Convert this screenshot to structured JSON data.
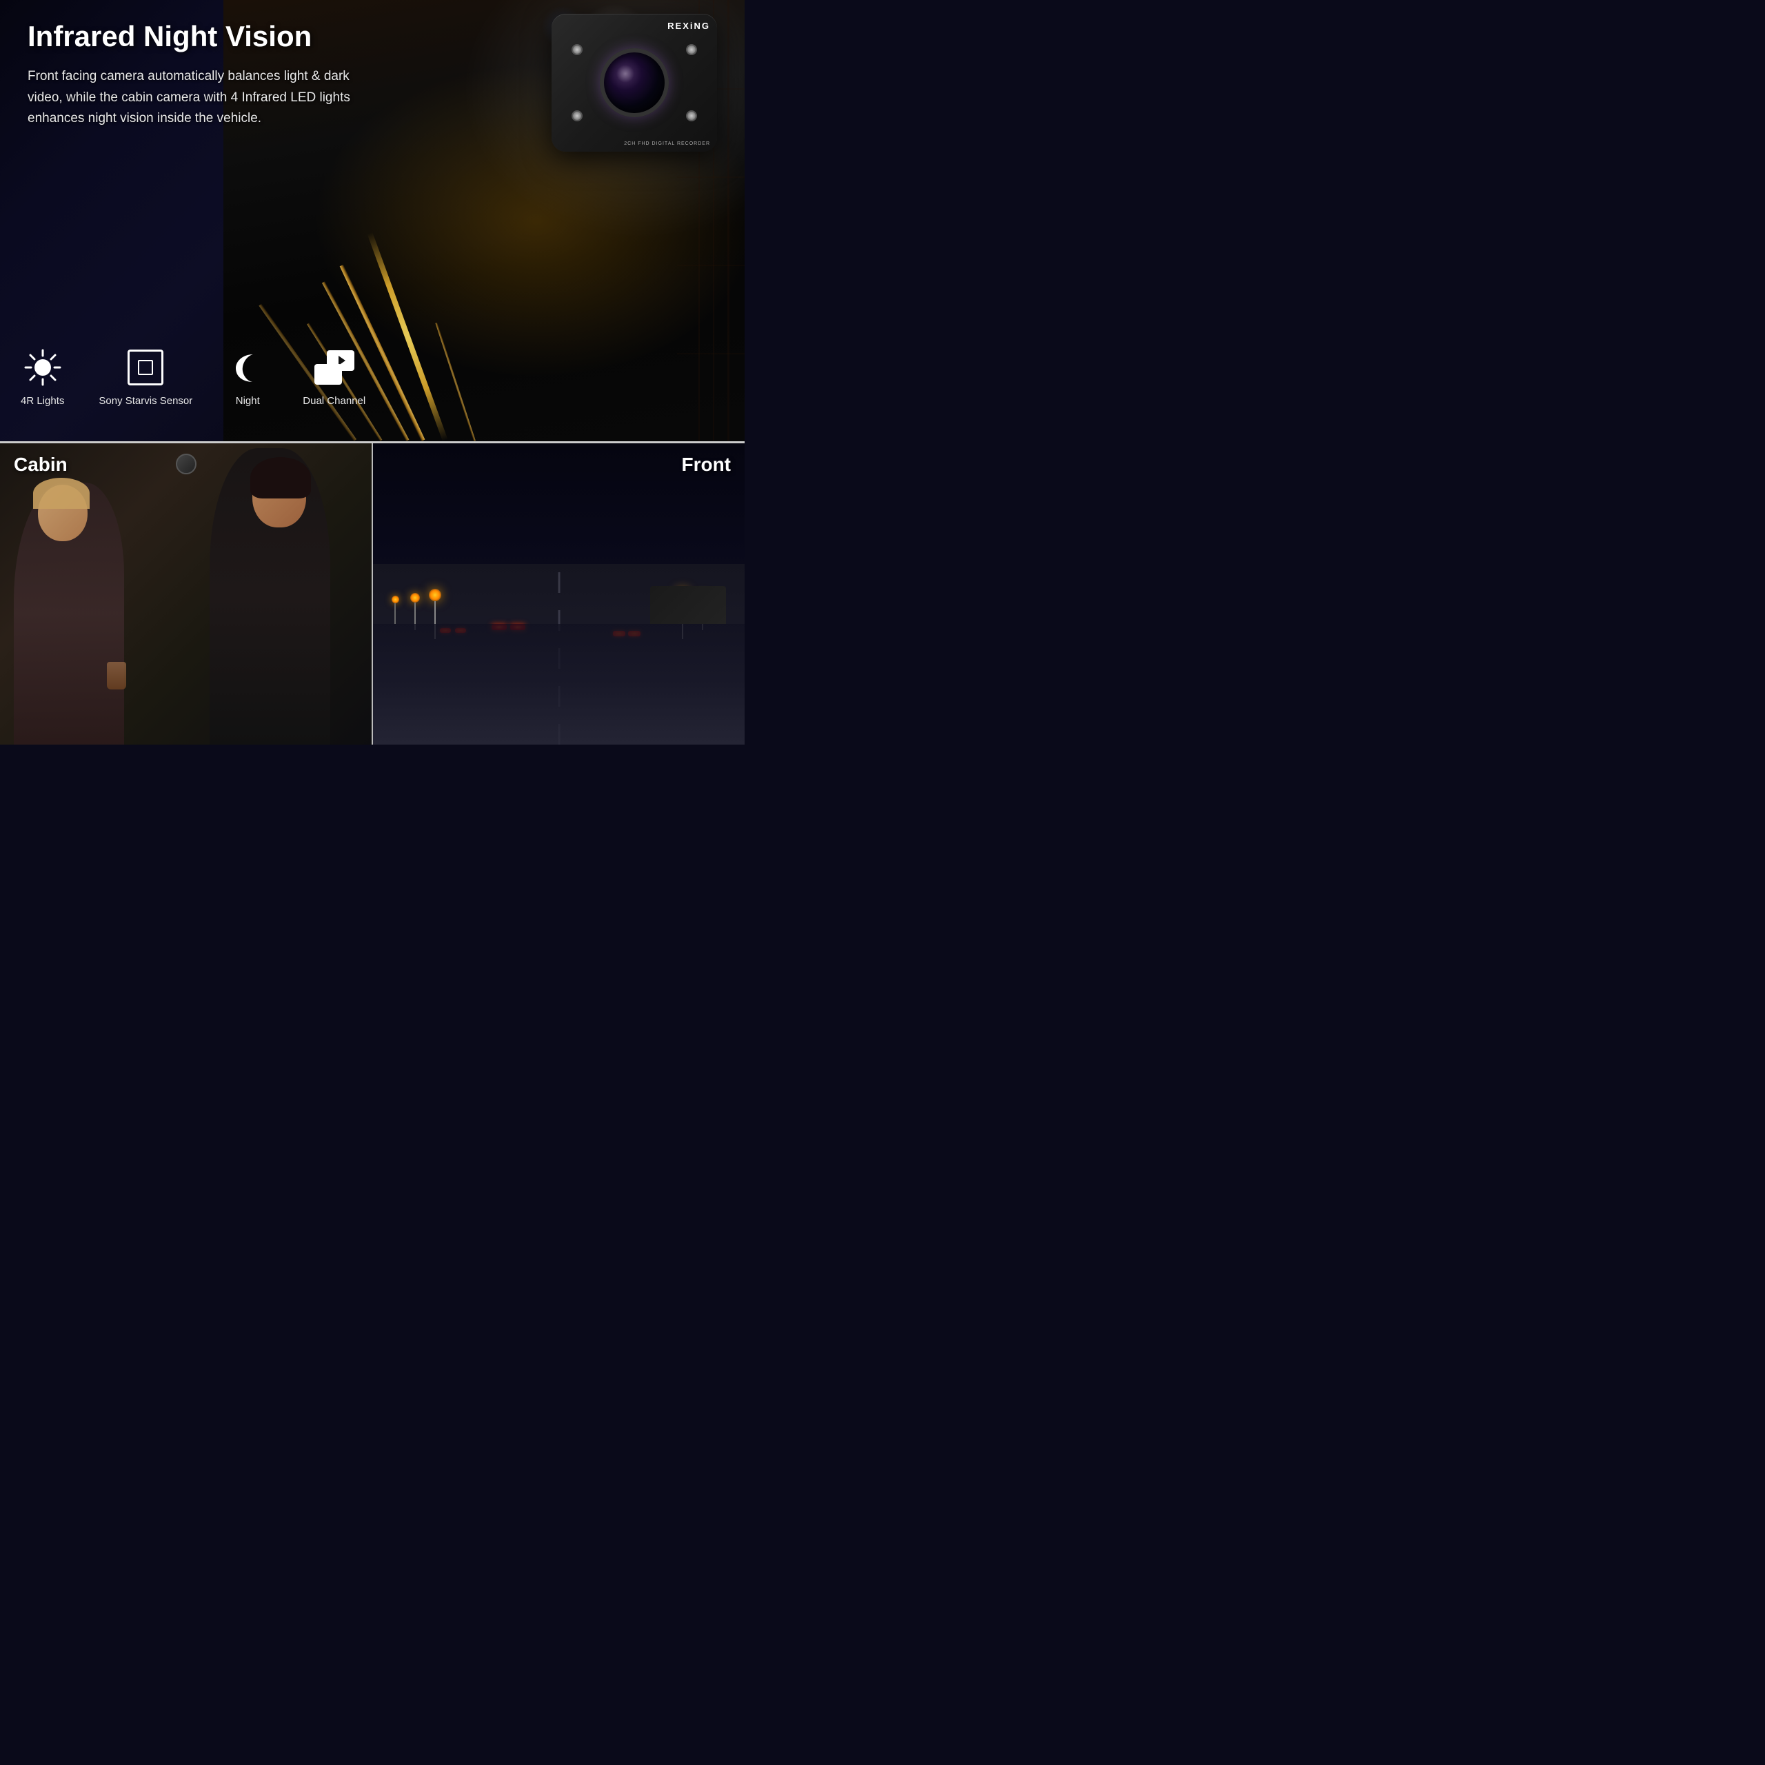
{
  "page": {
    "title": "Infrared Night Vision",
    "description": "Front facing camera automatically balances light & dark video, while the cabin camera with 4 Infrared LED lights enhances night vision inside the vehicle.",
    "brand": "REXiNG",
    "brand_subtitle": "2CH FHD DIGITAL RECORDER",
    "icons": [
      {
        "id": "lights",
        "label": "4R Lights"
      },
      {
        "id": "sensor",
        "label": "Sony Starvis Sensor"
      },
      {
        "id": "night",
        "label": "Night"
      },
      {
        "id": "dual",
        "label": "Dual Channel"
      }
    ],
    "bottom": {
      "cabin_label": "Cabin",
      "front_label": "Front"
    },
    "colors": {
      "bg_dark": "#050510",
      "text_white": "#ffffff",
      "accent_orange": "#f0a020"
    }
  }
}
